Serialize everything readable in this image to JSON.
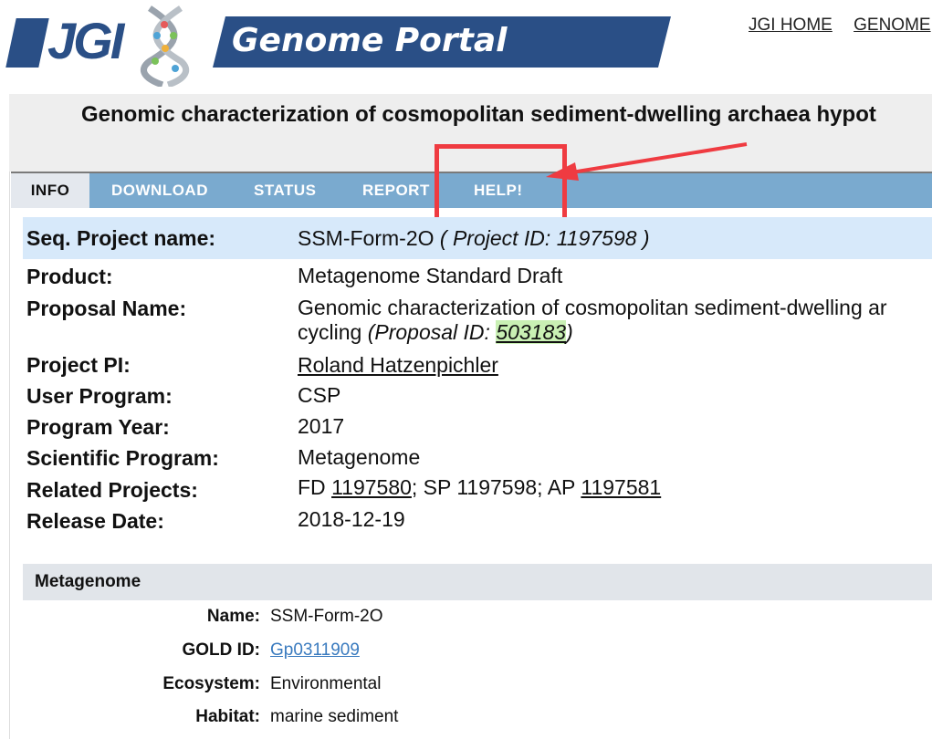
{
  "header": {
    "logo_text": "JGI",
    "portal_title": "Genome Portal",
    "top_links": [
      "JGI HOME",
      "GENOME"
    ]
  },
  "page_title": "Genomic characterization of cosmopolitan sediment-dwelling archaea hypot",
  "nav": {
    "tabs": [
      "INFO",
      "DOWNLOAD",
      "STATUS",
      "REPORT",
      "HELP!"
    ],
    "active": "INFO"
  },
  "info": {
    "seq_project_label": "Seq. Project name:",
    "seq_project_value": "SSM-Form-2O",
    "seq_project_id": "( Project ID: 1197598 )",
    "product_label": "Product:",
    "product_value": "Metagenome Standard Draft",
    "proposal_label": "Proposal Name:",
    "proposal_line1": "Genomic characterization of cosmopolitan sediment-dwelling ar",
    "proposal_line2_a": "cycling",
    "proposal_line2_b": "(Proposal ID: ",
    "proposal_id": "503183",
    "proposal_line2_c": ")",
    "pi_label": "Project PI:",
    "pi_value": "Roland Hatzenpichler",
    "user_program_label": "User Program:",
    "user_program_value": "CSP",
    "program_year_label": "Program Year:",
    "program_year_value": "2017",
    "sci_program_label": "Scientific Program:",
    "sci_program_value": "Metagenome",
    "related_label": "Related Projects:",
    "related_fd": "FD",
    "related_fd_id": "1197580",
    "related_sp": "; SP 1197598; AP",
    "related_ap_id": "1197581",
    "release_label": "Release Date:",
    "release_value": "2018-12-19"
  },
  "metagenome": {
    "section_title": "Metagenome",
    "name_label": "Name:",
    "name_value": "SSM-Form-2O",
    "gold_label": "GOLD ID:",
    "gold_value": "Gp0311909",
    "ecosystem_label": "Ecosystem:",
    "ecosystem_value": "Environmental",
    "habitat_label": "Habitat:",
    "habitat_value": "marine sediment"
  },
  "colors": {
    "brand_blue": "#2a4f86",
    "nav_blue": "#7aaacf",
    "highlight_red": "#ef3b41",
    "link_blue": "#3a7bbf"
  }
}
